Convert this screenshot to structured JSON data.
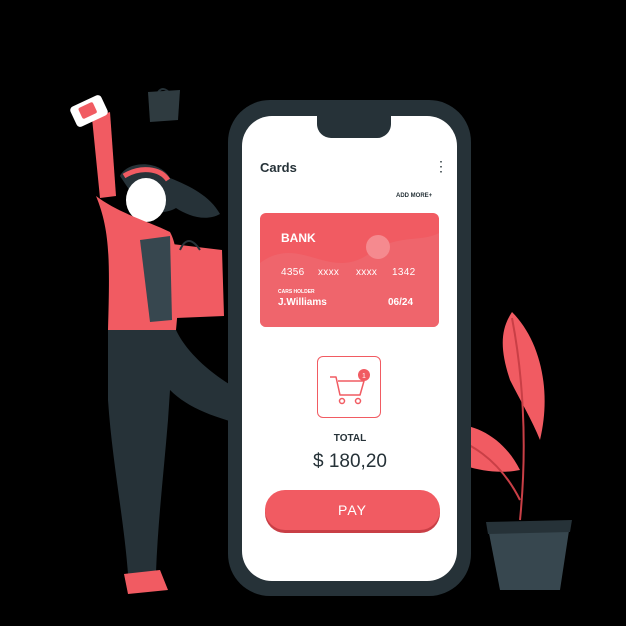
{
  "screen": {
    "title": "Cards",
    "add_more_label": "ADD MORE+"
  },
  "card": {
    "bank": "BANK",
    "number_groups": [
      "4356",
      "xxxx",
      "xxxx",
      "1342"
    ],
    "holder_label": "CARS HOLDER",
    "holder_name": "J.Williams",
    "expiry": "06/24"
  },
  "cart": {
    "badge_count": "1"
  },
  "total": {
    "label": "TOTAL",
    "amount": "$ 180,20"
  },
  "pay_label": "PAY",
  "icons": {
    "menu": "more-vertical-icon",
    "cart": "shopping-cart-icon"
  },
  "colors": {
    "accent": "#f15b62",
    "dark": "#263238",
    "screen": "#ffffff",
    "background": "#000000"
  }
}
